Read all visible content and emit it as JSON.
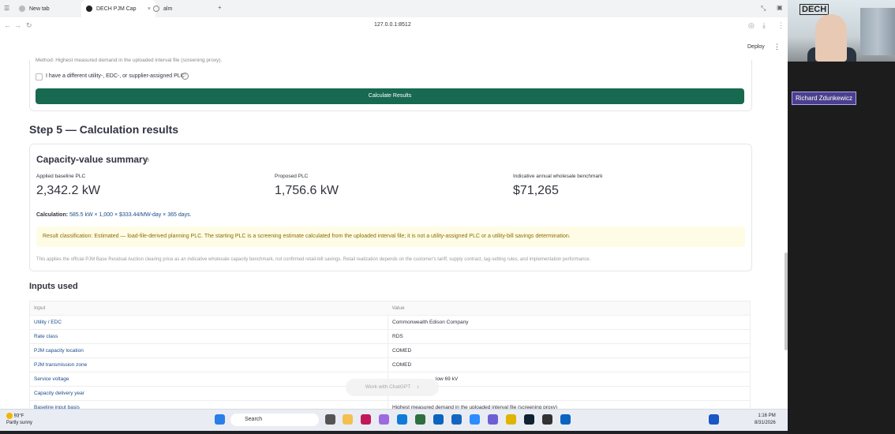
{
  "browser": {
    "tabs": [
      {
        "label": "New tab"
      },
      {
        "label": "DECH PJM Cap"
      },
      {
        "label": "alm"
      }
    ],
    "url": "127.0.0.1:8512"
  },
  "app": {
    "deploy_label": "Deploy",
    "method_note": "Method: Highest measured demand in the uploaded interval file (screening proxy).",
    "checkbox_label": "I have a different utility-, EDC-, or supplier-assigned PLC",
    "calculate_button": "Calculate Results",
    "step5_title": "Step 5 — Calculation results",
    "summary": {
      "title": "Capacity-value summary",
      "metrics": [
        {
          "label": "Applied baseline PLC",
          "value": "2,342.2 kW"
        },
        {
          "label": "Proposed PLC",
          "value": "1,756.6 kW"
        },
        {
          "label": "Indicative annual wholesale benchmark",
          "value": "$71,265"
        }
      ],
      "calc_label": "Calculation:",
      "calc_text": "585.5 kW × 1,000 × $333.44/MW-day × 365 days.",
      "warning": "Result classification: Estimated — load-file-derived planning PLC. The starting PLC is a screening estimate calculated from the uploaded interval file; it is not a utility-assigned PLC or a utility-bill savings determination.",
      "note": "This applies the official PJM Base Residual Auction clearing price as an indicative wholesale capacity benchmark, not confirmed retail-bill savings. Retail realization depends on the customer's tariff, supply contract, tag-setting rules, and implementation performance."
    },
    "inputs_title": "Inputs used",
    "table": {
      "headers": [
        "Input",
        "Value"
      ],
      "rows": [
        [
          "Utility / EDC",
          "Commonwealth Edison Company"
        ],
        [
          "Rate class",
          "RDS"
        ],
        [
          "PJM capacity location",
          "COMED"
        ],
        [
          "PJM transmission zone",
          "COMED"
        ],
        [
          "Service voltage",
          "low 69 kV"
        ],
        [
          "Capacity delivery year",
          ""
        ],
        [
          "Baseline input basis",
          "Highest measured demand in the uploaded interval file (screening proxy)"
        ]
      ]
    },
    "chatgpt_overlay": "Work with ChatGPT"
  },
  "taskbar": {
    "weather_temp": "93°F",
    "weather_desc": "Partly sunny",
    "search_label": "Search",
    "time": "1:16 PM",
    "date": "8/31/2026"
  },
  "video": {
    "participant_name": "Richard Zdunkewicz",
    "logo_text": "DECH"
  }
}
